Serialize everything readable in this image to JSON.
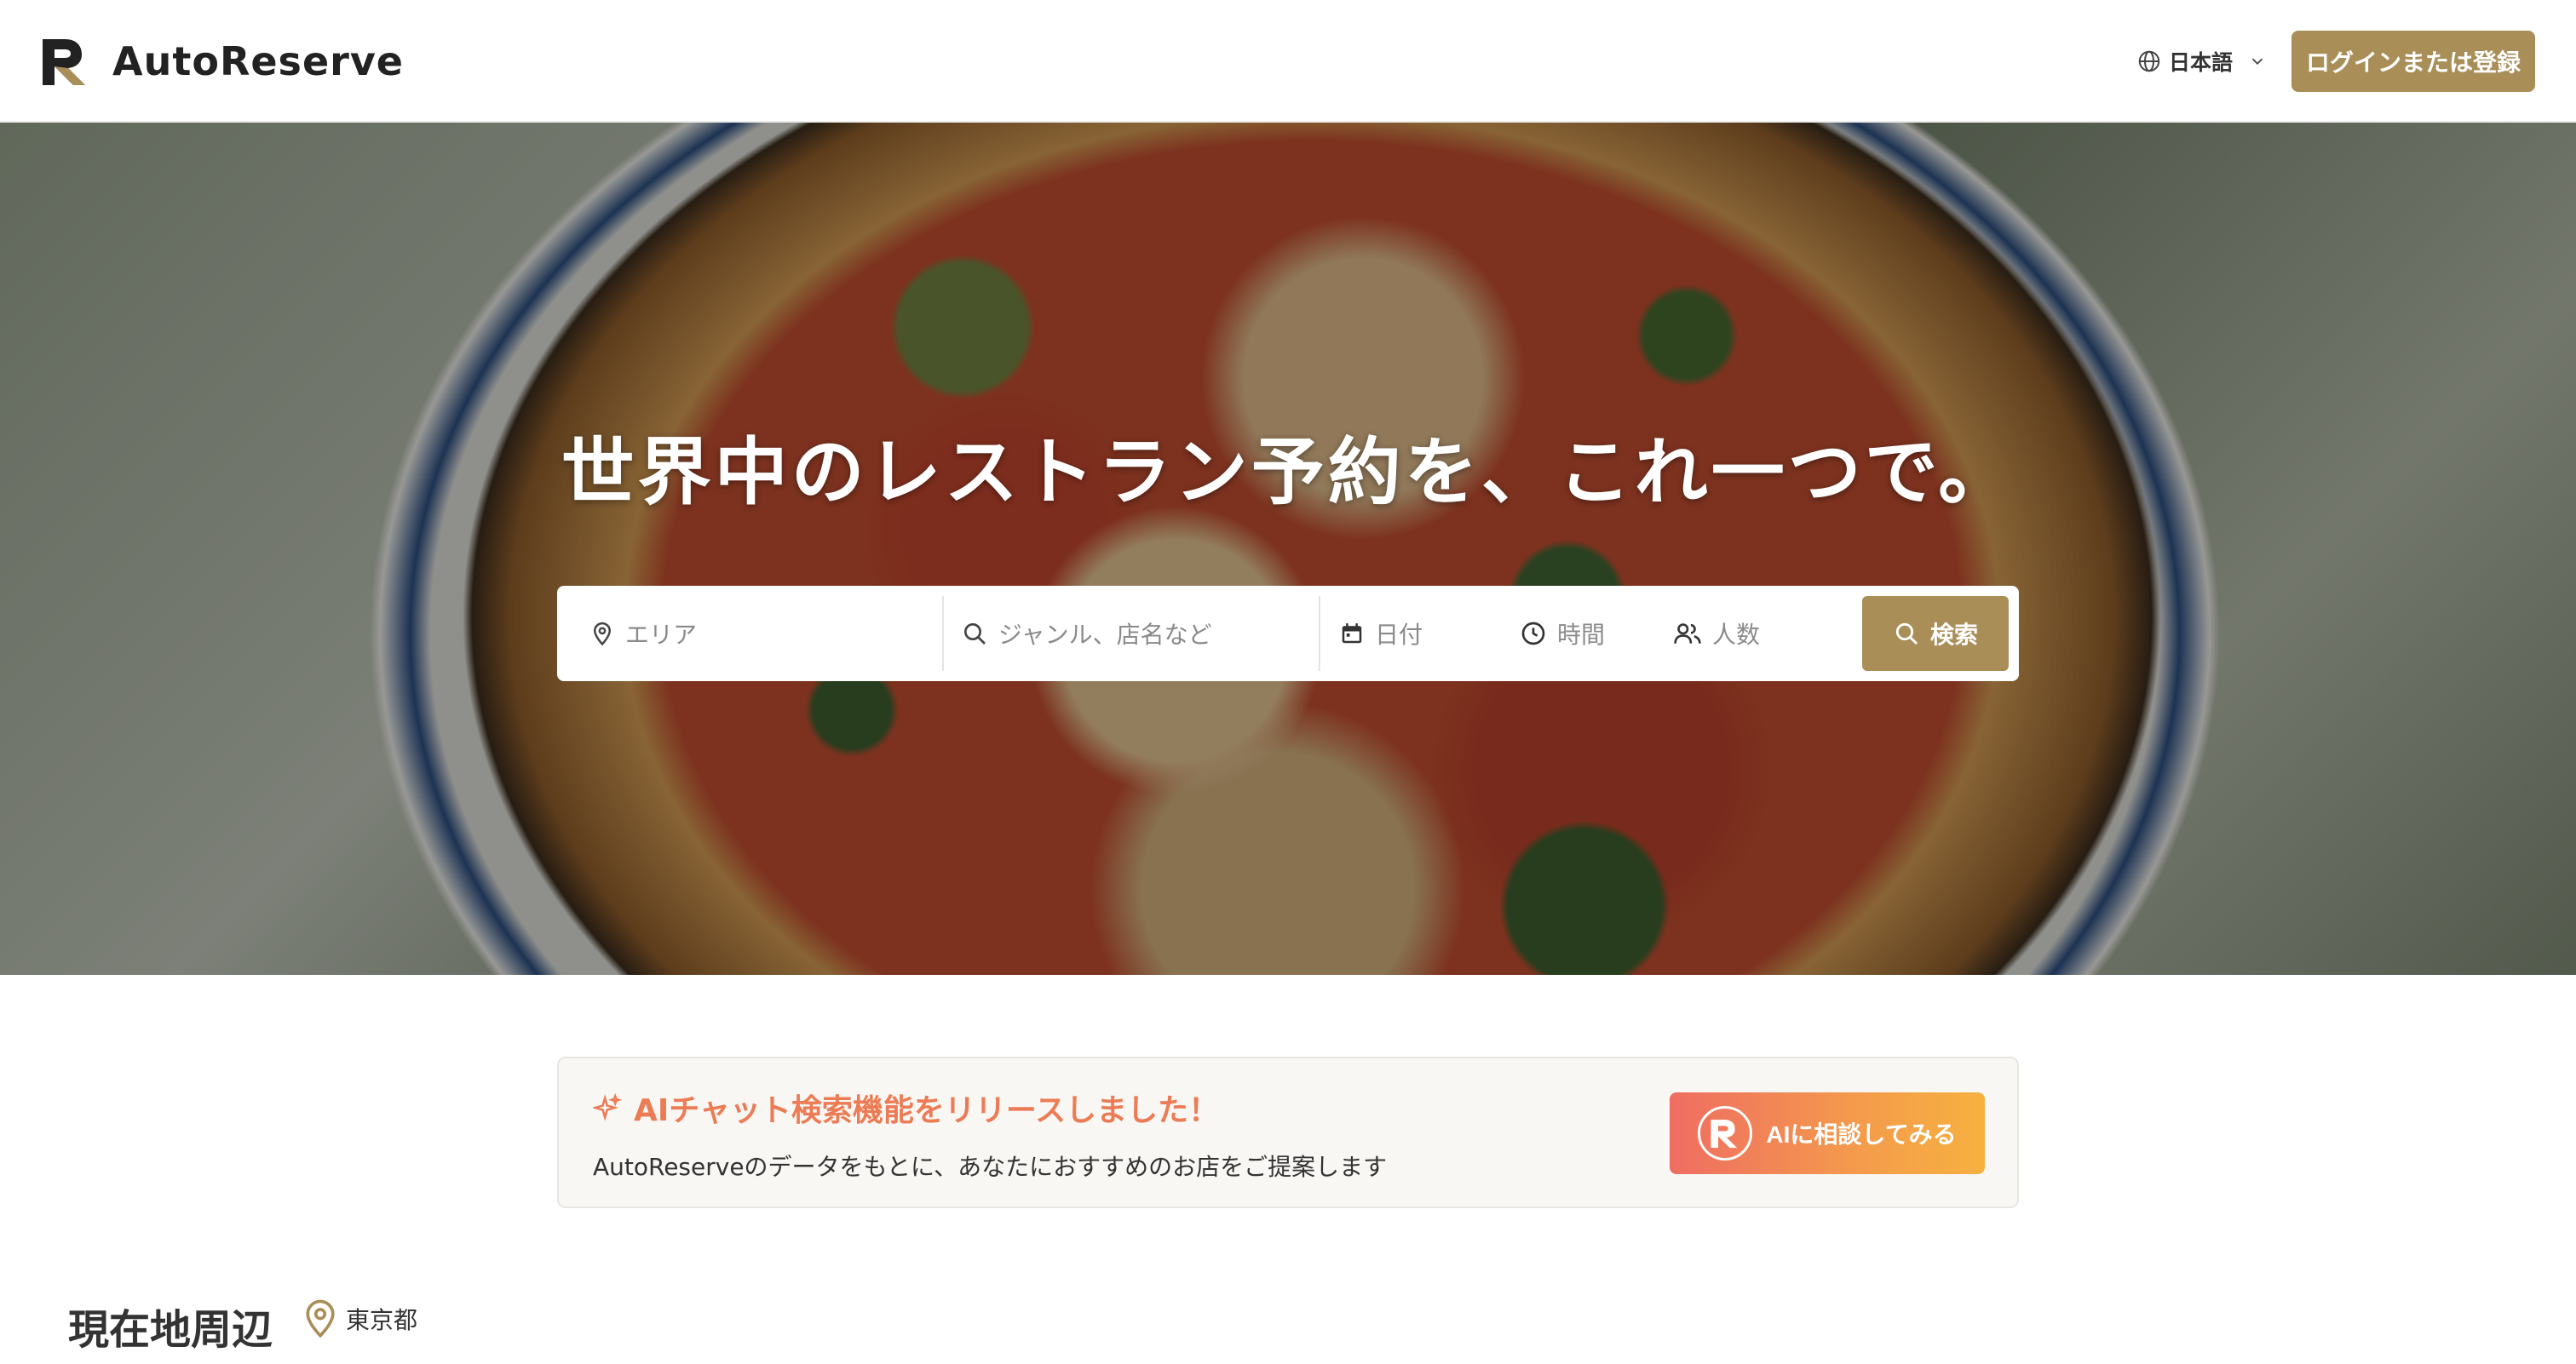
{
  "header": {
    "brand": "AutoReserve",
    "language": "日本語",
    "login_label": "ログインまたは登録"
  },
  "hero": {
    "title": "世界中のレストラン予約を、これ一つで。"
  },
  "search": {
    "area_placeholder": "エリア",
    "keyword_placeholder": "ジャンル、店名など",
    "date_placeholder": "日付",
    "time_placeholder": "時間",
    "people_placeholder": "人数",
    "submit_label": "検索"
  },
  "ai_banner": {
    "title": "AIチャット検索機能をリリースしました！",
    "description": "AutoReserveのデータをもとに、あなたにおすすめのお店をご提案します",
    "button_label": "AIに相談してみる"
  },
  "nearby": {
    "title": "現在地周辺",
    "location": "東京都"
  },
  "colors": {
    "accent": "#a98e58",
    "ai_gradient_start": "#ef6d62",
    "ai_gradient_end": "#f6b13f",
    "ai_title": "#ec7c55"
  },
  "icons": {
    "globe": "globe-icon",
    "chevron": "chevron-down-icon",
    "pin": "location-pin-icon",
    "search": "search-icon",
    "calendar": "calendar-icon",
    "clock": "clock-icon",
    "people": "people-icon",
    "sparkle": "sparkle-icon"
  }
}
